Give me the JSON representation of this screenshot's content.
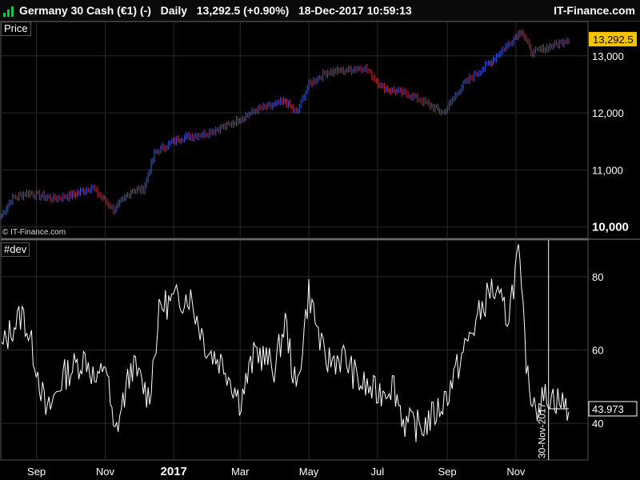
{
  "header": {
    "title": "Germany 30 Cash (€1) (-)   Daily   13,292.5 (+0.90%)   18-Dec-2017 10:59:13",
    "brand": "IT-Finance.com"
  },
  "panels": {
    "price_label": "Price",
    "dev_label": "#dev",
    "watermark": "© IT-Finance.com"
  },
  "colors": {
    "background": "#000000",
    "up_bar": "#3a5bd9",
    "down_bar": "#c0283a",
    "line": "#ffffff",
    "last_price_badge": "#f5c400",
    "grid": "#2a2a2a"
  },
  "chart_data": [
    {
      "type": "ohlc",
      "name": "Price",
      "ylim": [
        9800,
        13600
      ],
      "y_ticks": [
        "10,000",
        "11,000",
        "12,000",
        "13,000"
      ],
      "last_value": "13,292.5",
      "x_ticks": [
        "Sep",
        "Nov",
        "2017",
        "Mar",
        "May",
        "Jul",
        "Sep",
        "Nov"
      ],
      "anchors": [
        [
          "2016-08-01",
          10200
        ],
        [
          "2016-08-10",
          10500
        ],
        [
          "2016-08-25",
          10600
        ],
        [
          "2016-09-15",
          10500
        ],
        [
          "2016-10-01",
          10550
        ],
        [
          "2016-10-20",
          10700
        ],
        [
          "2016-11-09",
          10300
        ],
        [
          "2016-11-25",
          10650
        ],
        [
          "2016-12-05",
          10650
        ],
        [
          "2016-12-15",
          11300
        ],
        [
          "2017-01-05",
          11550
        ],
        [
          "2017-01-31",
          11650
        ],
        [
          "2017-02-20",
          11800
        ],
        [
          "2017-03-15",
          12050
        ],
        [
          "2017-04-10",
          12200
        ],
        [
          "2017-04-20",
          12000
        ],
        [
          "2017-05-01",
          12500
        ],
        [
          "2017-05-15",
          12700
        ],
        [
          "2017-06-20",
          12800
        ],
        [
          "2017-07-05",
          12450
        ],
        [
          "2017-08-01",
          12300
        ],
        [
          "2017-08-29",
          12000
        ],
        [
          "2017-09-15",
          12500
        ],
        [
          "2017-10-10",
          12900
        ],
        [
          "2017-11-06",
          13450
        ],
        [
          "2017-11-15",
          13050
        ],
        [
          "2017-12-18",
          13290
        ]
      ]
    },
    {
      "type": "line",
      "name": "#dev",
      "ylim": [
        30,
        90
      ],
      "y_ticks": [
        "40",
        "60",
        "80"
      ],
      "last_value": "43.973",
      "cursor_label": "30-Nov-2017",
      "anchors": [
        [
          "2016-08-01",
          60
        ],
        [
          "2016-08-10",
          66
        ],
        [
          "2016-08-20",
          70
        ],
        [
          "2016-09-01",
          56
        ],
        [
          "2016-09-10",
          42
        ],
        [
          "2016-09-25",
          53
        ],
        [
          "2016-10-15",
          58
        ],
        [
          "2016-10-25",
          50
        ],
        [
          "2016-11-01",
          58
        ],
        [
          "2016-11-09",
          36
        ],
        [
          "2016-11-25",
          56
        ],
        [
          "2016-12-10",
          47
        ],
        [
          "2016-12-20",
          72
        ],
        [
          "2017-01-15",
          75
        ],
        [
          "2017-01-31",
          60
        ],
        [
          "2017-02-15",
          56
        ],
        [
          "2017-03-01",
          46
        ],
        [
          "2017-03-15",
          60
        ],
        [
          "2017-04-01",
          55
        ],
        [
          "2017-04-10",
          68
        ],
        [
          "2017-04-20",
          48
        ],
        [
          "2017-05-01",
          76
        ],
        [
          "2017-05-15",
          57
        ],
        [
          "2017-06-01",
          58
        ],
        [
          "2017-06-15",
          51
        ],
        [
          "2017-07-01",
          48
        ],
        [
          "2017-07-15",
          51
        ],
        [
          "2017-07-25",
          40
        ],
        [
          "2017-08-10",
          39
        ],
        [
          "2017-08-25",
          44
        ],
        [
          "2017-09-01",
          48
        ],
        [
          "2017-09-20",
          63
        ],
        [
          "2017-10-10",
          77
        ],
        [
          "2017-10-25",
          69
        ],
        [
          "2017-11-01",
          82
        ],
        [
          "2017-11-03",
          87
        ],
        [
          "2017-11-12",
          50
        ],
        [
          "2017-11-20",
          45
        ],
        [
          "2017-11-30",
          48
        ],
        [
          "2017-12-18",
          44
        ]
      ]
    }
  ]
}
